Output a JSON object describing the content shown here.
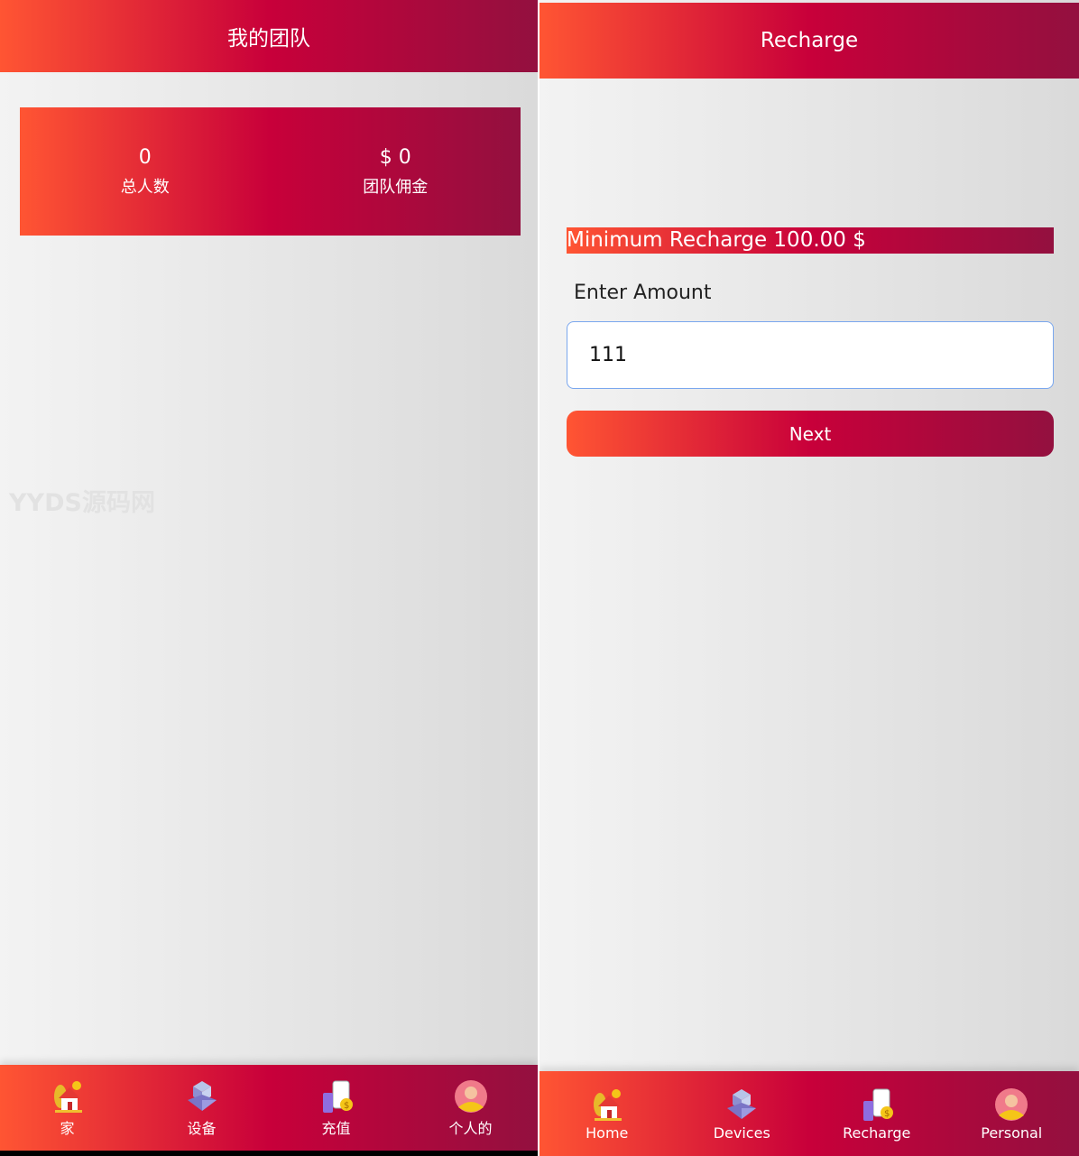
{
  "left": {
    "header": {
      "title": "我的团队"
    },
    "stats": [
      {
        "value": "0",
        "label": "总人数"
      },
      {
        "value": "$ 0",
        "label": "团队佣金"
      }
    ],
    "watermark": "YYDS源码网",
    "nav": [
      {
        "label": "家",
        "icon": "home-icon"
      },
      {
        "label": "设备",
        "icon": "devices-icon"
      },
      {
        "label": "充值",
        "icon": "recharge-icon"
      },
      {
        "label": "个人的",
        "icon": "personal-icon"
      }
    ]
  },
  "right": {
    "header": {
      "title": "Recharge"
    },
    "minimum": "Minimum Recharge 100.00 $",
    "amount_label": "Enter Amount",
    "amount_value": "111",
    "next_label": "Next",
    "nav": [
      {
        "label": "Home",
        "icon": "home-icon"
      },
      {
        "label": "Devices",
        "icon": "devices-icon"
      },
      {
        "label": "Recharge",
        "icon": "recharge-icon"
      },
      {
        "label": "Personal",
        "icon": "personal-icon"
      }
    ]
  },
  "colors": {
    "gradient_start": "#ff5533",
    "gradient_mid": "#c8003a",
    "gradient_end": "#93103f"
  }
}
